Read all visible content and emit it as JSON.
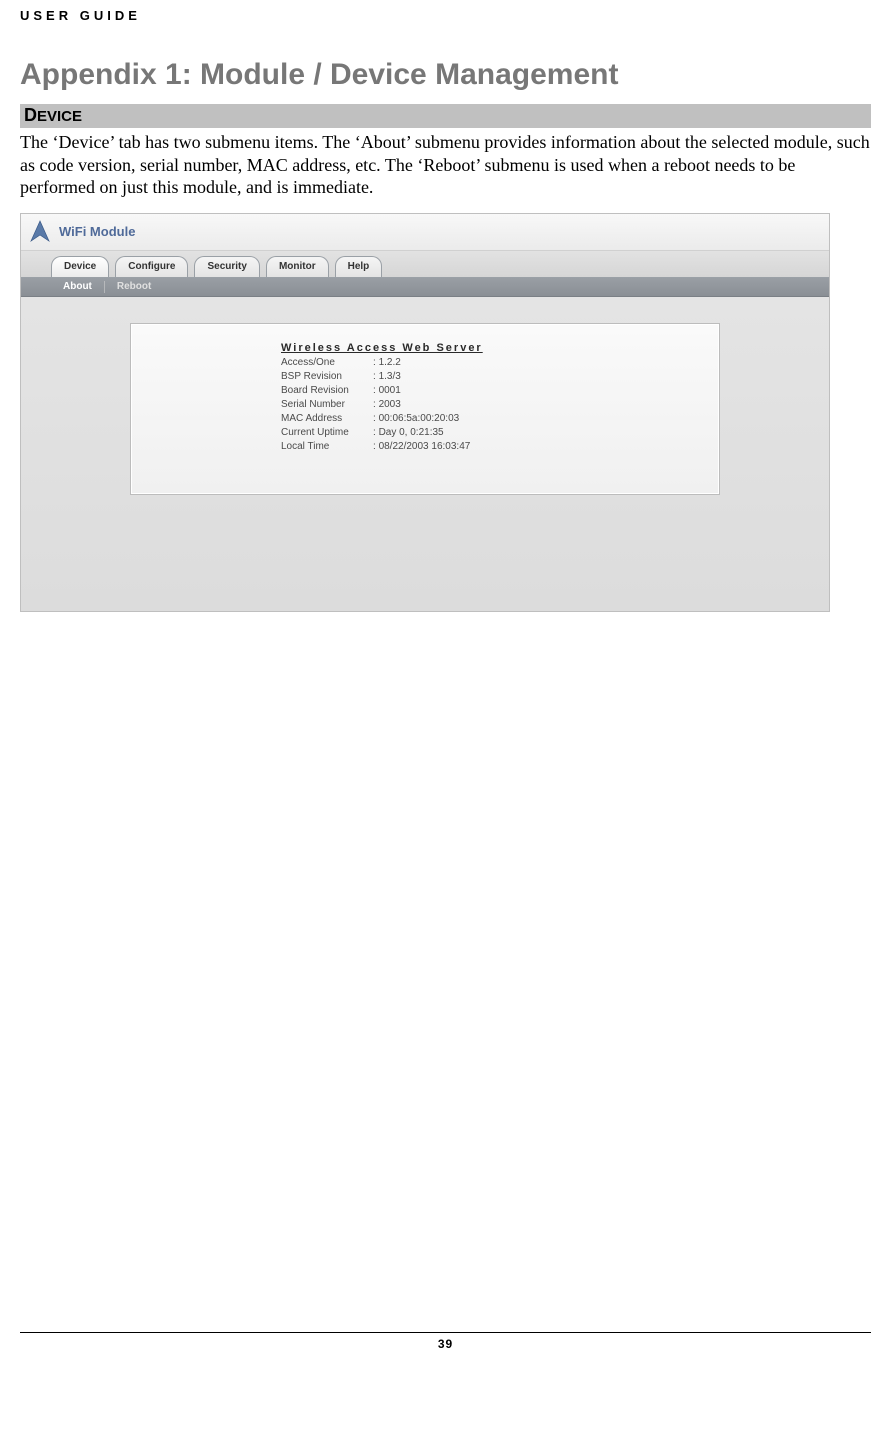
{
  "doc": {
    "header": "USER GUIDE",
    "title": "Appendix 1: Module / Device Management",
    "section_first": "D",
    "section_rest": "EVICE",
    "paragraph": "The ‘Device’ tab has two submenu items. The ‘About’ submenu provides information about the selected module, such as code version, serial number, MAC address, etc. The ‘Reboot’ submenu is used when a reboot needs to be performed on just this module, and is immediate.",
    "page_number": "39"
  },
  "ui": {
    "module_title": "WiFi Module",
    "tabs": [
      {
        "label": "Device",
        "active": true
      },
      {
        "label": "Configure",
        "active": false
      },
      {
        "label": "Security",
        "active": false
      },
      {
        "label": "Monitor",
        "active": false
      },
      {
        "label": "Help",
        "active": false
      }
    ],
    "subtabs": [
      {
        "label": "About",
        "active": true
      },
      {
        "label": "Reboot",
        "active": false
      }
    ],
    "panel": {
      "title": "Wireless Access Web Server",
      "rows": [
        {
          "label": "Access/One",
          "value": "1.2.2"
        },
        {
          "label": "BSP Revision",
          "value": "1.3/3"
        },
        {
          "label": "Board Revision",
          "value": "0001"
        },
        {
          "label": "Serial Number",
          "value": "2003"
        },
        {
          "label": "MAC Address",
          "value": "00:06:5a:00:20:03"
        },
        {
          "label": "Current Uptime",
          "value": "Day 0, 0:21:35"
        },
        {
          "label": "Local Time",
          "value": "08/22/2003 16:03:47"
        }
      ]
    }
  }
}
